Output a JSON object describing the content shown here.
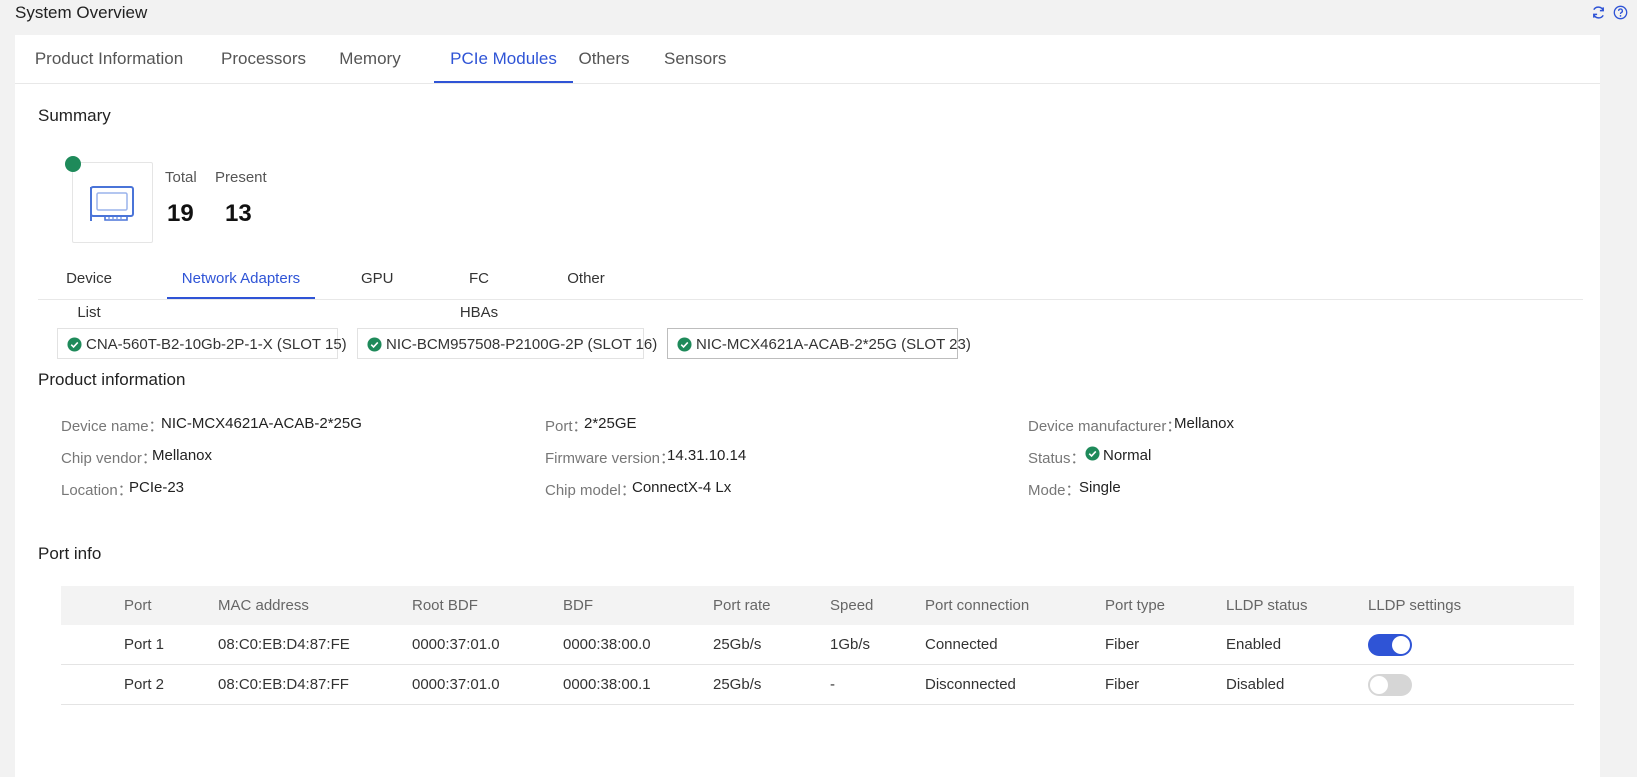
{
  "page": {
    "title": "System Overview",
    "icons": [
      "refresh-icon",
      "help-icon"
    ]
  },
  "main_tabs": [
    {
      "label": "Product Information"
    },
    {
      "label": "Processors"
    },
    {
      "label": "Memory"
    },
    {
      "label": "PCIe Modules",
      "active": true
    },
    {
      "label": "Others"
    },
    {
      "label": "Sensors"
    }
  ],
  "summary": {
    "title": "Summary",
    "total_label": "Total",
    "total_value": "19",
    "present_label": "Present",
    "present_value": "13",
    "status_color": "#1e8a5a"
  },
  "sub_tabs": [
    {
      "label": "Device List"
    },
    {
      "label": "Network Adapters",
      "active": true
    },
    {
      "label": "GPU"
    },
    {
      "label": "FC HBAs"
    },
    {
      "label": "Other"
    }
  ],
  "adapters": [
    {
      "label": "CNA-560T-B2-10Gb-2P-1-X (SLOT 15)"
    },
    {
      "label": "NIC-BCM957508-P2100G-2P (SLOT 16)"
    },
    {
      "label": "NIC-MCX4621A-ACAB-2*25G (SLOT 23)",
      "selected": true
    }
  ],
  "product_info": {
    "title": "Product information",
    "device_name": {
      "label": "Device name：",
      "value": "NIC-MCX4621A-ACAB-2*25G"
    },
    "chip_vendor": {
      "label": "Chip vendor：",
      "value": "Mellanox"
    },
    "location": {
      "label": "Location：",
      "value": "PCIe-23"
    },
    "port": {
      "label": "Port：",
      "value": "2*25GE"
    },
    "firmware_version": {
      "label": "Firmware version：",
      "value": "14.31.10.14"
    },
    "chip_model": {
      "label": "Chip model：",
      "value": "ConnectX-4 Lx"
    },
    "device_manufacturer": {
      "label": "Device manufacturer：",
      "value": "Mellanox"
    },
    "status": {
      "label": "Status：",
      "value": "Normal"
    },
    "mode": {
      "label": "Mode：",
      "value": "Single"
    }
  },
  "port_info": {
    "title": "Port info",
    "columns": [
      "Port",
      "MAC address",
      "Root BDF",
      "BDF",
      "Port rate",
      "Speed",
      "Port connection",
      "Port type",
      "LLDP status",
      "LLDP settings"
    ],
    "rows": [
      {
        "port": "Port 1",
        "mac": "08:C0:EB:D4:87:FE",
        "root_bdf": "0000:37:01.0",
        "bdf": "0000:38:00.0",
        "port_rate": "25Gb/s",
        "speed": "1Gb/s",
        "connection": "Connected",
        "type": "Fiber",
        "lldp_status": "Enabled",
        "lldp_on": true
      },
      {
        "port": "Port 2",
        "mac": "08:C0:EB:D4:87:FF",
        "root_bdf": "0000:37:01.0",
        "bdf": "0000:38:00.1",
        "port_rate": "25Gb/s",
        "speed": "-",
        "connection": "Disconnected",
        "type": "Fiber",
        "lldp_status": "Disabled",
        "lldp_on": false
      }
    ]
  },
  "colors": {
    "accent": "#2f54d6",
    "ok_green": "#1e8a5a"
  }
}
